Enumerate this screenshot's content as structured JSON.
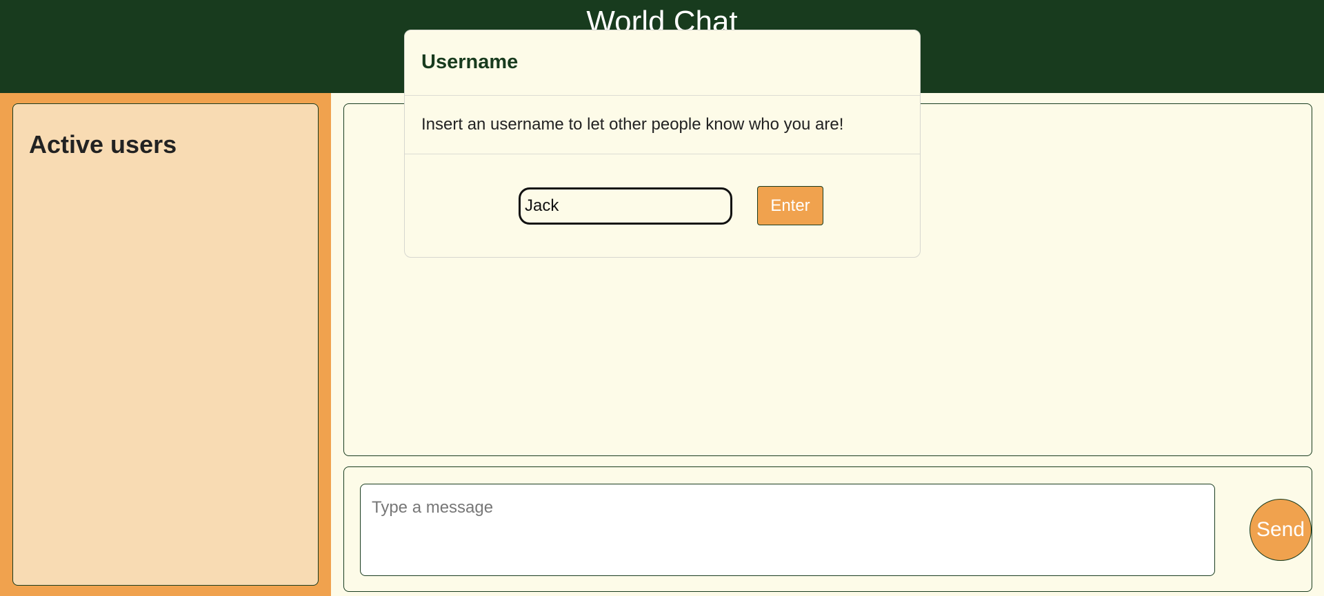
{
  "header": {
    "title": "World Chat"
  },
  "sidebar": {
    "title": "Active users",
    "users": []
  },
  "chat": {
    "messages": [],
    "composer": {
      "placeholder": "Type a message",
      "value": ""
    },
    "send_label": "Send"
  },
  "modal": {
    "title": "Username",
    "text": "Insert an username to let other people know who you are!",
    "input_value": "Jack",
    "enter_label": "Enter"
  },
  "colors": {
    "header_bg": "#183b1e",
    "sidebar_bg": "#f0a24e",
    "users_panel_bg": "#f8dbb3",
    "main_bg": "#fdfbe8",
    "accent": "#f0a24e"
  }
}
